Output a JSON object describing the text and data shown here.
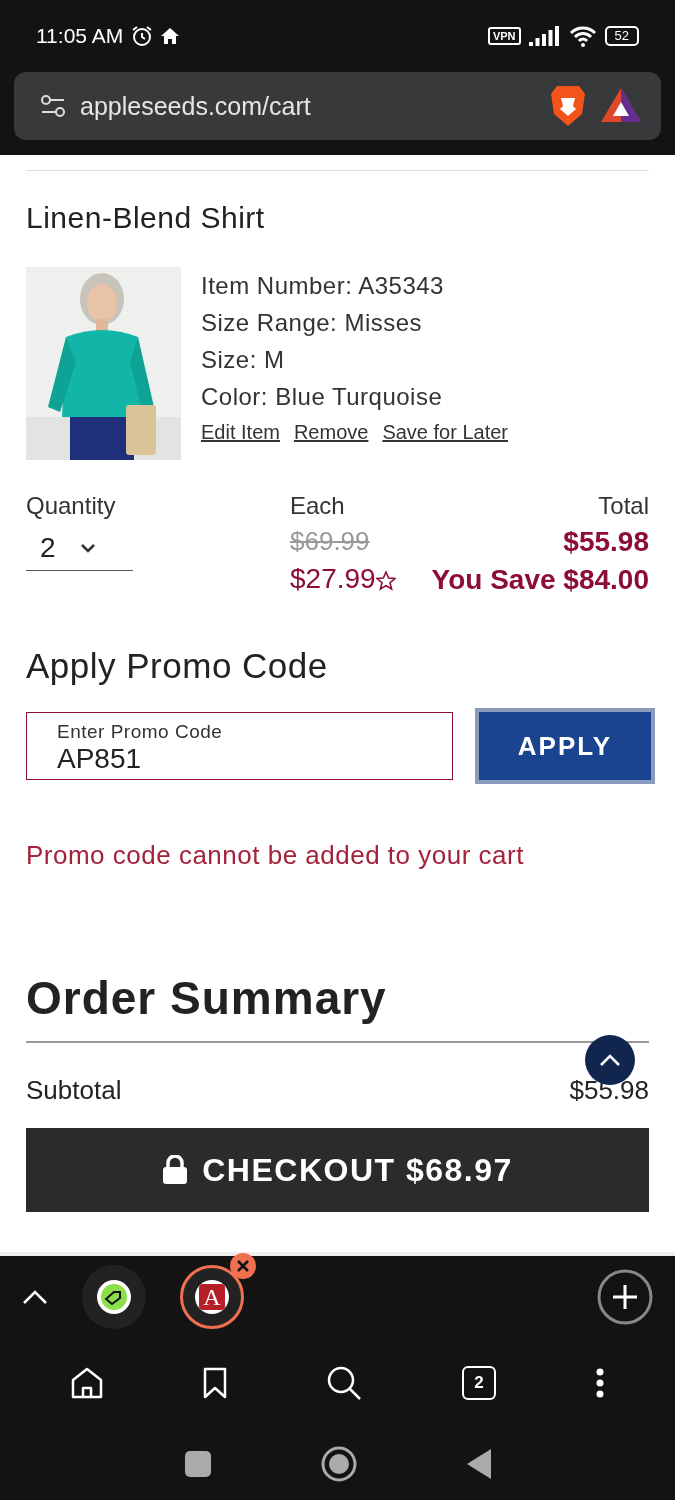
{
  "status_bar": {
    "time": "11:05 AM",
    "vpn": "VPN",
    "battery": "52"
  },
  "address_bar": {
    "url": "appleseeds.com/cart"
  },
  "cart_item": {
    "name": "Linen-Blend Shirt",
    "image": {
      "kind": "picture"
    },
    "details": [
      "Item Number: A35343",
      "Size Range: Misses",
      "Size: M",
      "Color: Blue Turquoise"
    ],
    "actions": [
      "Edit Item",
      "Remove",
      "Save for Later"
    ],
    "quantity": {
      "label": "Quantity",
      "value": "2"
    },
    "each": {
      "label": "Each",
      "original_price": "$69.99",
      "sale_price": "$27.99"
    },
    "total": {
      "label": "Total",
      "price": "$55.98",
      "savings": "You Save $84.00"
    }
  },
  "promo": {
    "title": "Apply Promo Code",
    "field": {
      "placeholder": "Enter Promo Code",
      "value": "AP851"
    },
    "button": "APPLY",
    "error": "Promo code cannot be added to your cart"
  },
  "order_summary": {
    "title": "Order Summary",
    "rows": [
      {
        "label": "Subtotal",
        "value": "$55.98"
      }
    ],
    "checkout": "CHECKOUT $68.97"
  },
  "browser_tabs": [
    {
      "kind": "tag",
      "selected": false
    },
    {
      "kind": "letter",
      "letter": "A",
      "selected": true
    }
  ],
  "toolbar": {
    "tab_count": "2"
  }
}
